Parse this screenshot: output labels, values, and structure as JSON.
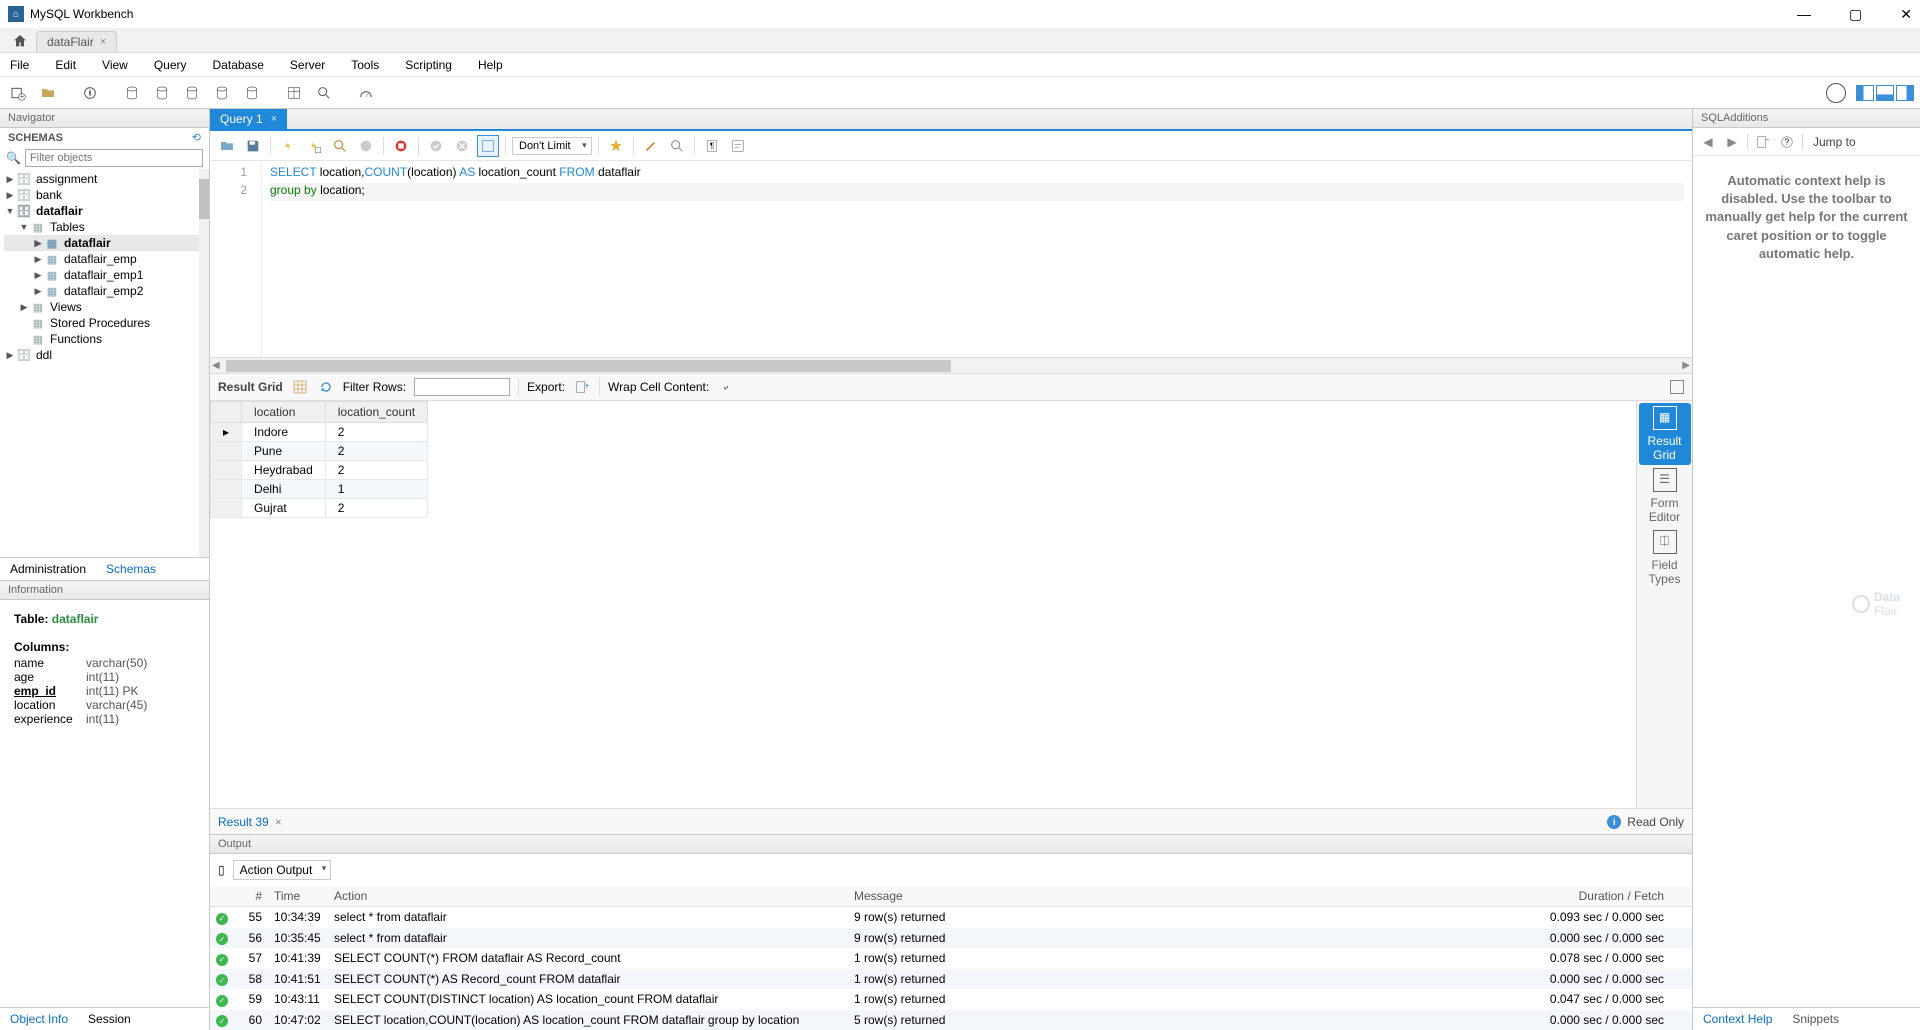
{
  "app": {
    "title": "MySQL Workbench",
    "connection_tab": "dataFlair"
  },
  "menubar": [
    "File",
    "Edit",
    "View",
    "Query",
    "Database",
    "Server",
    "Tools",
    "Scripting",
    "Help"
  ],
  "navigator": {
    "title": "Navigator",
    "schemas_label": "SCHEMAS",
    "filter_placeholder": "Filter objects",
    "tabs": {
      "admin": "Administration",
      "schemas": "Schemas"
    },
    "tree": {
      "assignment": "assignment",
      "bank": "bank",
      "dataflair": "dataflair",
      "tables": "Tables",
      "tbl_dataflair": "dataflair",
      "tbl_emp": "dataflair_emp",
      "tbl_emp1": "dataflair_emp1",
      "tbl_emp2": "dataflair_emp2",
      "views": "Views",
      "sp": "Stored Procedures",
      "fn": "Functions",
      "ddl": "ddl"
    }
  },
  "information": {
    "title": "Information",
    "table_label": "Table: ",
    "table_name": "dataflair",
    "columns_label": "Columns:",
    "columns": [
      {
        "name": "name",
        "type": "varchar(50)"
      },
      {
        "name": "age",
        "type": "int(11)"
      },
      {
        "name": "emp_id",
        "type": "int(11) PK",
        "pk": true
      },
      {
        "name": "location",
        "type": "varchar(45)"
      },
      {
        "name": "experience",
        "type": "int(11)"
      }
    ],
    "tabs": {
      "object": "Object Info",
      "session": "Session"
    }
  },
  "query": {
    "tab_label": "Query 1",
    "limit": "Don't Limit",
    "lines": {
      "l1": "1",
      "l2": "2"
    },
    "sql1_a": "SELECT",
    "sql1_b": " location,",
    "sql1_c": "COUNT",
    "sql1_d": "(location) ",
    "sql1_e": "AS",
    "sql1_f": " location_count ",
    "sql1_g": "FROM",
    "sql1_h": " dataflair",
    "sql2_a": "group",
    "sql2_b": " ",
    "sql2_c": "by",
    "sql2_d": " location;"
  },
  "result": {
    "bar": {
      "grid_label": "Result Grid",
      "filter_label": "Filter Rows:",
      "export_label": "Export:",
      "wrap_label": "Wrap Cell Content:"
    },
    "headers": {
      "h1": "location",
      "h2": "location_count"
    },
    "rows": [
      {
        "location": "Indore",
        "count": "2"
      },
      {
        "location": "Pune",
        "count": "2"
      },
      {
        "location": "Heydrabad",
        "count": "2"
      },
      {
        "location": "Delhi",
        "count": "1"
      },
      {
        "location": "Gujrat",
        "count": "2"
      }
    ],
    "tab_label": "Result 39",
    "readonly": "Read Only",
    "side": {
      "grid": "Result\nGrid",
      "form": "Form\nEditor",
      "types": "Field\nTypes"
    }
  },
  "output": {
    "title": "Output",
    "selector": "Action Output",
    "headers": {
      "n": "#",
      "t": "Time",
      "a": "Action",
      "m": "Message",
      "d": "Duration / Fetch"
    },
    "rows": [
      {
        "n": "55",
        "t": "10:34:39",
        "a": "select * from dataflair",
        "m": "9 row(s) returned",
        "d": "0.093 sec / 0.000 sec"
      },
      {
        "n": "56",
        "t": "10:35:45",
        "a": "select * from dataflair",
        "m": "9 row(s) returned",
        "d": "0.000 sec / 0.000 sec"
      },
      {
        "n": "57",
        "t": "10:41:39",
        "a": "SELECT COUNT(*) FROM dataflair AS Record_count",
        "m": "1 row(s) returned",
        "d": "0.078 sec / 0.000 sec"
      },
      {
        "n": "58",
        "t": "10:41:51",
        "a": "SELECT COUNT(*) AS Record_count FROM dataflair",
        "m": "1 row(s) returned",
        "d": "0.000 sec / 0.000 sec"
      },
      {
        "n": "59",
        "t": "10:43:11",
        "a": "SELECT COUNT(DISTINCT location) AS location_count FROM dataflair",
        "m": "1 row(s) returned",
        "d": "0.047 sec / 0.000 sec"
      },
      {
        "n": "60",
        "t": "10:47:02",
        "a": "SELECT location,COUNT(location) AS location_count FROM dataflair  group by location",
        "m": "5 row(s) returned",
        "d": "0.000 sec / 0.000 sec"
      }
    ]
  },
  "additions": {
    "title": "SQLAdditions",
    "jump": "Jump to",
    "help": "Automatic context help is disabled. Use the toolbar to manually get help for the current caret position or to toggle automatic help.",
    "tabs": {
      "ctx": "Context Help",
      "snip": "Snippets"
    }
  },
  "watermark": {
    "a": "Data",
    "b": "Flair"
  }
}
